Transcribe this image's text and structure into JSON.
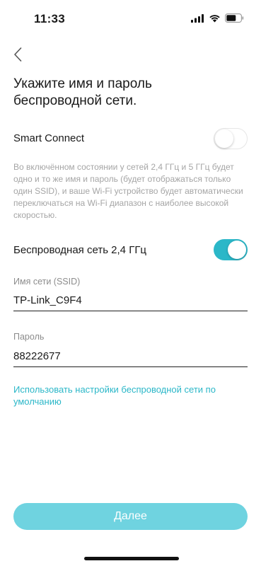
{
  "status_bar": {
    "time": "11:33"
  },
  "page": {
    "title": "Укажите имя и пароль беспроводной сети."
  },
  "smart_connect": {
    "label": "Smart Connect",
    "enabled": false,
    "description": "Во включённом состоянии у сетей 2,4 ГГц и 5 ГГц будет одно и то же имя и пароль (будет отображаться только один SSID), и ваше Wi-Fi устройство будет автоматически переключаться на Wi-Fi диапазон с наиболее высокой скоростью."
  },
  "wireless_24": {
    "label": "Беспроводная сеть 2,4 ГГц",
    "enabled": true
  },
  "ssid": {
    "label": "Имя сети (SSID)",
    "value": "TP-Link_C9F4"
  },
  "password": {
    "label": "Пароль",
    "value": "88222677"
  },
  "default_link": {
    "label": "Использовать настройки беспроводной сети по умолчанию"
  },
  "next_button": {
    "label": "Далее"
  },
  "colors": {
    "accent": "#2bb7c8",
    "button_disabled": "#6fd3e0"
  }
}
